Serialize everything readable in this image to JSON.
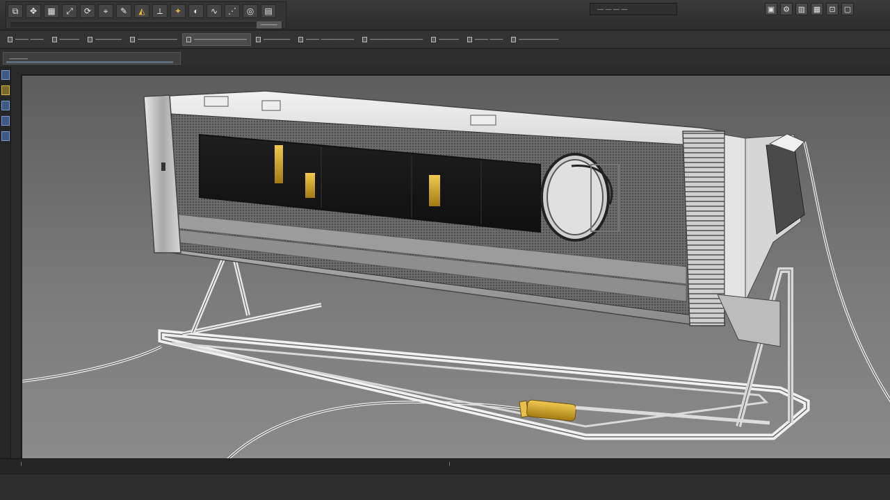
{
  "toolbar": {
    "tools": [
      {
        "icon": "select-icon",
        "glyph": "⧉"
      },
      {
        "icon": "move-icon",
        "glyph": "✥"
      },
      {
        "icon": "grid-icon",
        "glyph": "▦"
      },
      {
        "icon": "scale-icon",
        "glyph": "⤢"
      },
      {
        "icon": "rotate-icon",
        "glyph": "⟳"
      },
      {
        "icon": "snap-icon",
        "glyph": "⌖"
      },
      {
        "icon": "pen-icon",
        "glyph": "✎"
      },
      {
        "icon": "mirror-icon",
        "glyph": "◭"
      },
      {
        "icon": "measure-icon",
        "glyph": "⟂"
      },
      {
        "icon": "light-icon",
        "glyph": "✦"
      },
      {
        "icon": "camera-icon",
        "glyph": "◐"
      },
      {
        "icon": "curve-icon",
        "glyph": "∿"
      },
      {
        "icon": "sweep-icon",
        "glyph": "⋰"
      },
      {
        "icon": "render-icon",
        "glyph": "◎"
      },
      {
        "icon": "panel-icon",
        "glyph": "▤"
      }
    ],
    "chip_label": "———"
  },
  "right_toolbar": {
    "status": "— —  — —",
    "buttons": [
      {
        "icon": "layout-icon",
        "glyph": "▣"
      },
      {
        "icon": "settings-icon",
        "glyph": "⚙"
      },
      {
        "icon": "layers-icon",
        "glyph": "▥"
      },
      {
        "icon": "view-icon",
        "glyph": "▦"
      },
      {
        "icon": "snap-toggle-icon",
        "glyph": "⊡"
      },
      {
        "icon": "display-icon",
        "glyph": "▢"
      }
    ]
  },
  "menu": {
    "items": [
      {
        "label": "——  ——",
        "active": false
      },
      {
        "label": "———",
        "active": false
      },
      {
        "label": "————",
        "active": false
      },
      {
        "label": "——————",
        "active": false
      },
      {
        "label": "————————",
        "active": true
      },
      {
        "label": "————",
        "active": false
      },
      {
        "label": "——  —————",
        "active": false
      },
      {
        "label": "————————",
        "active": false
      },
      {
        "label": "———",
        "active": false
      },
      {
        "label": "——  ——",
        "active": false
      },
      {
        "label": "——————",
        "active": false
      }
    ]
  },
  "view_tab": {
    "label": "———"
  },
  "colors": {
    "accent": "#e0b43a",
    "viewport_bg_top": "#5a5a5a",
    "viewport_bg_bottom": "#8c8c8c"
  }
}
